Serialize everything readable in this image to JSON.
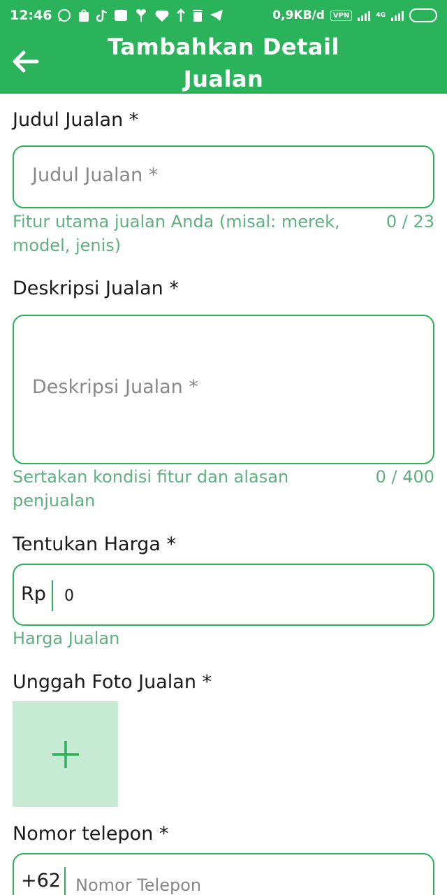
{
  "status_bar": {
    "time": "12:46",
    "network_speed": "0,9KB/d",
    "vpn_label": "VPN",
    "network_type": "4G"
  },
  "app_bar": {
    "title_line1": "Tambahkan Detail",
    "title_line2": "Jualan",
    "icon": "arrow-left-icon"
  },
  "form": {
    "title": {
      "label": "Judul Jualan *",
      "placeholder": "Judul Jualan *",
      "helper_line1": "Fitur utama jualan Anda (misal: merek,",
      "helper_line2": "model, jenis)",
      "counter": "0 / 23"
    },
    "description": {
      "label": "Deskripsi Jualan *",
      "placeholder": "Deskripsi Jualan *",
      "helper_line1": "Sertakan kondisi fitur dan alasan",
      "helper_line2": "penjualan",
      "counter": "0 / 400"
    },
    "price": {
      "label": "Tentukan Harga *",
      "prefix": "Rp",
      "value": "0",
      "helper": "Harga Jualan"
    },
    "photo": {
      "label": "Unggah Foto Jualan *",
      "icon": "plus-icon"
    },
    "phone": {
      "label": "Nomor telepon *",
      "prefix": "+62",
      "placeholder": "Nomor Telepon"
    }
  },
  "colors": {
    "primary": "#2bb35b",
    "upload_bg": "#c6ead3",
    "helper_text": "#5fb07f"
  }
}
